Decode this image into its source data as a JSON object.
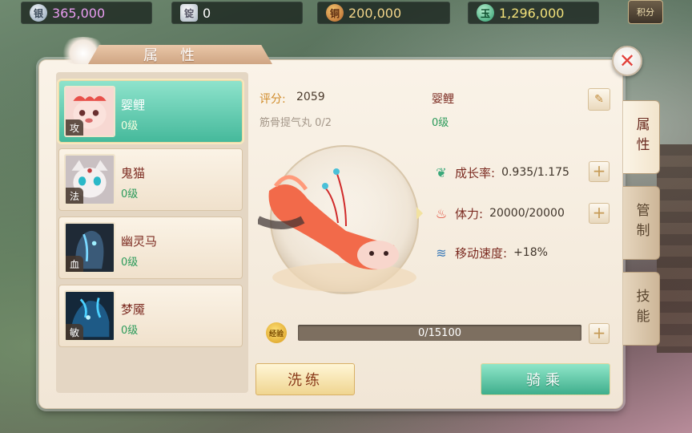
{
  "currencies": [
    {
      "icon": "silver-ingot-icon",
      "glyph": "银",
      "value": "365,000"
    },
    {
      "icon": "silver-bar-icon",
      "glyph": "锭",
      "value": "0"
    },
    {
      "icon": "copper-coin-icon",
      "glyph": "铜",
      "value": "200,000"
    },
    {
      "icon": "jade-coin-icon",
      "glyph": "玉",
      "value": "1,296,000"
    }
  ],
  "jifen_label": "积分",
  "window": {
    "title": "属性",
    "close_glyph": "✕"
  },
  "pets": [
    {
      "name": "婴鲤",
      "level": "0级",
      "tag": "攻",
      "selected": true
    },
    {
      "name": "鬼猫",
      "level": "0级",
      "tag": "法",
      "selected": false
    },
    {
      "name": "幽灵马",
      "level": "0级",
      "tag": "血",
      "selected": false
    },
    {
      "name": "梦魇",
      "level": "0级",
      "tag": "敏",
      "selected": false
    }
  ],
  "detail": {
    "score_label": "评分:",
    "score_value": "2059",
    "item_line": "筋骨提气丸 0/2",
    "name": "婴鲤",
    "level": "0级",
    "edit_glyph": "✎"
  },
  "stats": [
    {
      "icon": "leaf-icon",
      "glyph": "❦",
      "label": "成长率:",
      "value": "0.935/1.175"
    },
    {
      "icon": "blood-drop-icon",
      "glyph": "♨",
      "label": "体力:",
      "value": "20000/20000"
    },
    {
      "icon": "wind-icon",
      "glyph": "≋",
      "label": "移动速度:",
      "value": "+18%"
    }
  ],
  "exp": {
    "icon_label": "经验",
    "text": "0/15100",
    "current": 0,
    "max": 15100
  },
  "plus_glyph": "+",
  "buttons": {
    "wash": "洗练",
    "ride": "骑乘"
  },
  "side_tabs": [
    {
      "label": "属性",
      "active": true
    },
    {
      "label": "管制",
      "active": false
    },
    {
      "label": "技能",
      "active": false
    }
  ],
  "colors": {
    "accent_green": "#45b99b",
    "name_red": "#7b2a20",
    "level_green": "#2b9a5a"
  }
}
